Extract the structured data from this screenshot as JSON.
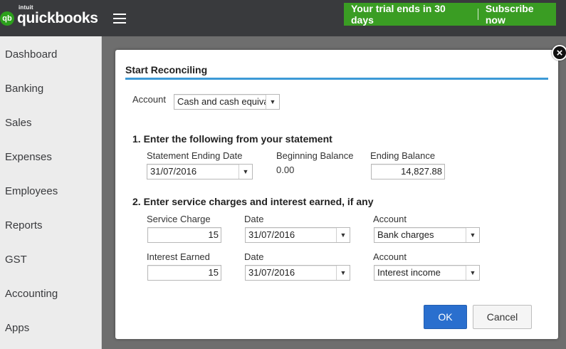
{
  "brand": {
    "intuit_label": "intuit",
    "product_name": "quickbooks",
    "logo_glyph": "qb",
    "accent_color": "#2ca01c"
  },
  "header": {
    "trial_text": "Your trial ends in 30 days",
    "subscribe_label": "Subscribe now",
    "menu_icon": "hamburger-icon"
  },
  "sidebar": {
    "items": [
      {
        "label": "Dashboard"
      },
      {
        "label": "Banking"
      },
      {
        "label": "Sales"
      },
      {
        "label": "Expenses"
      },
      {
        "label": "Employees"
      },
      {
        "label": "Reports"
      },
      {
        "label": "GST"
      },
      {
        "label": "Accounting"
      },
      {
        "label": "Apps"
      }
    ]
  },
  "dialog": {
    "title": "Start Reconciling",
    "close_glyph": "×",
    "account_label": "Account",
    "account_value": "Cash and cash equival",
    "section1": {
      "heading": "1. Enter the following from your statement",
      "statement_date_label": "Statement Ending Date",
      "statement_date_value": "31/07/2016",
      "beginning_balance_label": "Beginning Balance",
      "beginning_balance_value": "0.00",
      "ending_balance_label": "Ending Balance",
      "ending_balance_value": "14,827.88"
    },
    "section2": {
      "heading": "2. Enter service charges and interest earned, if any",
      "service_charge_label": "Service Charge",
      "service_charge_value": "15",
      "service_date_label": "Date",
      "service_date_value": "31/07/2016",
      "service_account_label": "Account",
      "service_account_value": "Bank charges",
      "interest_label": "Interest Earned",
      "interest_value": "15",
      "interest_date_label": "Date",
      "interest_date_value": "31/07/2016",
      "interest_account_label": "Account",
      "interest_account_value": "Interest income"
    },
    "ok_label": "OK",
    "cancel_label": "Cancel"
  }
}
